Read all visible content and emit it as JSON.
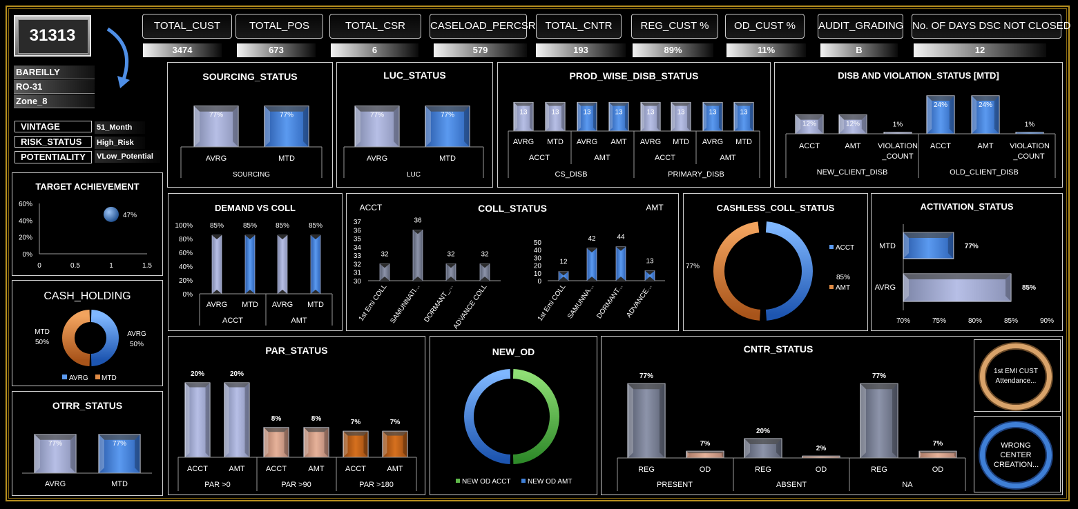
{
  "header": {
    "code": "31313",
    "locations": [
      "BAREILLY",
      "RO-31",
      "Zone_8"
    ]
  },
  "kpis": [
    {
      "label": "TOTAL_CUST",
      "value": "3474"
    },
    {
      "label": "TOTAL_POS",
      "value": "673"
    },
    {
      "label": "TOTAL_CSR",
      "value": "6"
    },
    {
      "label": "CASELOAD_PERCSR",
      "value": "579"
    },
    {
      "label": "TOTAL_CNTR",
      "value": "193"
    },
    {
      "label": "REG_CUST %",
      "value": "89%"
    },
    {
      "label": "OD_CUST %",
      "value": "11%"
    },
    {
      "label": "AUDIT_GRADING",
      "value": "B"
    },
    {
      "label": "No. OF DAYS DSC NOT CLOSED",
      "value": "12"
    }
  ],
  "profile": [
    {
      "label": "VINTAGE",
      "value": "51_Month"
    },
    {
      "label": "RISK_STATUS",
      "value": "High_Risk"
    },
    {
      "label": "POTENTIALITY",
      "value": "VLow_Potential"
    }
  ],
  "colors": {
    "gold": "#b8901f",
    "blue": "#3f7fd6",
    "lavender": "#b7bfe6",
    "peach": "#e6b29a",
    "orange": "#d6701e",
    "green": "#5fb84a"
  },
  "sourcing": {
    "title": "SOURCING_STATUS",
    "bars": [
      {
        "label": "AVRG",
        "value": "77%"
      },
      {
        "label": "MTD",
        "value": "77%"
      }
    ],
    "group": "SOURCING"
  },
  "luc": {
    "title": "LUC_STATUS",
    "bars": [
      {
        "label": "AVRG",
        "value": "77%"
      },
      {
        "label": "MTD",
        "value": "77%"
      }
    ],
    "group": "LUC"
  },
  "prod": {
    "title": "PROD_WISE_DISB_STATUS",
    "values": [
      "13",
      "13",
      "13",
      "13",
      "13",
      "13",
      "13",
      "13"
    ],
    "cats": [
      "AVRG",
      "MTD",
      "AVRG",
      "AMT",
      "AVRG",
      "MTD",
      "AVRG",
      "MTD"
    ],
    "sub": [
      "ACCT",
      "AMT",
      "ACCT",
      "AMT"
    ],
    "groups": [
      "CS_DISB",
      "PRIMARY_DISB"
    ]
  },
  "disb": {
    "title": "DISB AND VIOLATION_STATUS [MTD]",
    "values": [
      "12%",
      "12%",
      "1%",
      "24%",
      "24%",
      "1%"
    ],
    "cats": [
      "ACCT",
      "AMT",
      "VIOLATION",
      "ACCT",
      "AMT",
      "VIOLATION"
    ],
    "cats2": [
      "_COUNT",
      "_COUNT"
    ],
    "groups": [
      "NEW_CLIENT_DISB",
      "OLD_CLIENT_DISB"
    ]
  },
  "target": {
    "title": "TARGET ACHIEVEMENT",
    "point_label": "47%",
    "yticks": [
      "60%",
      "40%",
      "20%",
      "0%"
    ],
    "xticks": [
      "0",
      "0.5",
      "1",
      "1.5"
    ],
    "x": 1,
    "y": 0.47
  },
  "cash_holding": {
    "title": "CASH_HOLDING",
    "left_label": "MTD",
    "left_value": "50%",
    "right_label": "AVRG",
    "right_value": "50%",
    "legend": [
      "AVRG",
      "MTD"
    ]
  },
  "otrr": {
    "title": "OTRR_STATUS",
    "bars": [
      {
        "label": "AVRG",
        "value": "77%"
      },
      {
        "label": "MTD",
        "value": "77%"
      }
    ]
  },
  "demand": {
    "title": "DEMAND VS COLL",
    "yticks": [
      "100%",
      "80%",
      "60%",
      "40%",
      "20%",
      "0%"
    ],
    "values": [
      "85%",
      "85%",
      "85%",
      "85%"
    ],
    "cats": [
      "AVRG",
      "MTD",
      "AVRG",
      "MTD"
    ],
    "groups": [
      "ACCT",
      "AMT"
    ]
  },
  "coll": {
    "title": "COLL_STATUS",
    "left_label": "ACCT",
    "right_label": "AMT",
    "left_yticks": [
      "37",
      "36",
      "35",
      "34",
      "33",
      "32",
      "31",
      "30"
    ],
    "left_values": [
      "32",
      "36",
      "32",
      "32"
    ],
    "right_yticks": [
      "50",
      "40",
      "30",
      "20",
      "10",
      "0"
    ],
    "right_values": [
      "12",
      "42",
      "44",
      "13"
    ],
    "cats": [
      "1st Emi COLL",
      "SAMUNNATI...",
      "DORMANT_...",
      "ADVANCE COLL"
    ],
    "cats_right": [
      "1st Emi COLL",
      "SAMUNNA...",
      "DORMANT...",
      "ADVANCE..."
    ]
  },
  "cashless": {
    "title": "CASHLESS_COLL_STATUS",
    "left_value": "77%",
    "right_value": "85%",
    "legend": [
      "ACCT",
      "AMT"
    ]
  },
  "activation": {
    "title": "ACTIVATION_STATUS",
    "bars": [
      {
        "label": "MTD",
        "value": "77%"
      },
      {
        "label": "AVRG",
        "value": "85%"
      }
    ],
    "xticks": [
      "70%",
      "75%",
      "80%",
      "85%",
      "90%"
    ]
  },
  "par": {
    "title": "PAR_STATUS",
    "values": [
      "20%",
      "20%",
      "8%",
      "8%",
      "7%",
      "7%"
    ],
    "cats": [
      "ACCT",
      "AMT",
      "ACCT",
      "AMT",
      "ACCT",
      "AMT"
    ],
    "groups": [
      "PAR >0",
      "PAR >90",
      "PAR >180"
    ]
  },
  "new_od": {
    "title": "NEW_OD",
    "legend": [
      "NEW OD ACCT",
      "NEW OD AMT"
    ]
  },
  "cntr": {
    "title": "CNTR_STATUS",
    "values": [
      "77%",
      "7%",
      "20%",
      "2%",
      "77%",
      "7%"
    ],
    "cats": [
      "REG",
      "OD",
      "REG",
      "OD",
      "REG",
      "OD"
    ],
    "groups": [
      "PRESENT",
      "ABSENT",
      "NA"
    ]
  },
  "buttons": {
    "emi": "1st EMI CUST Attendance...",
    "wrong": "WRONG CENTER CREATION..."
  },
  "chart_data": [
    {
      "type": "bar",
      "title": "SOURCING_STATUS",
      "categories": [
        "AVRG",
        "MTD"
      ],
      "values": [
        77,
        77
      ],
      "xlabel": "SOURCING"
    },
    {
      "type": "bar",
      "title": "LUC_STATUS",
      "categories": [
        "AVRG",
        "MTD"
      ],
      "values": [
        77,
        77
      ],
      "xlabel": "LUC"
    },
    {
      "type": "bar",
      "title": "PROD_WISE_DISB_STATUS",
      "categories": [
        "CS_DISB ACCT AVRG",
        "CS_DISB ACCT MTD",
        "CS_DISB AMT AVRG",
        "CS_DISB AMT AMT",
        "PRIMARY_DISB ACCT AVRG",
        "PRIMARY_DISB ACCT MTD",
        "PRIMARY_DISB AMT AVRG",
        "PRIMARY_DISB AMT MTD"
      ],
      "values": [
        13,
        13,
        13,
        13,
        13,
        13,
        13,
        13
      ]
    },
    {
      "type": "bar",
      "title": "DISB AND VIOLATION_STATUS [MTD]",
      "categories": [
        "NEW ACCT",
        "NEW AMT",
        "NEW VIOLATION_COUNT",
        "OLD ACCT",
        "OLD AMT",
        "OLD VIOLATION_COUNT"
      ],
      "values": [
        12,
        12,
        1,
        24,
        24,
        1
      ]
    },
    {
      "type": "scatter",
      "title": "TARGET ACHIEVEMENT",
      "x": [
        1
      ],
      "y": [
        47
      ],
      "ylim": [
        0,
        60
      ],
      "xlim": [
        0,
        1.5
      ]
    },
    {
      "type": "pie",
      "title": "CASH_HOLDING",
      "categories": [
        "AVRG",
        "MTD"
      ],
      "values": [
        50,
        50
      ]
    },
    {
      "type": "bar",
      "title": "OTRR_STATUS",
      "categories": [
        "AVRG",
        "MTD"
      ],
      "values": [
        77,
        77
      ]
    },
    {
      "type": "bar",
      "title": "DEMAND VS COLL",
      "categories": [
        "ACCT AVRG",
        "ACCT MTD",
        "AMT AVRG",
        "AMT MTD"
      ],
      "values": [
        85,
        85,
        85,
        85
      ],
      "ylim": [
        0,
        100
      ]
    },
    {
      "type": "bar",
      "title": "COLL_STATUS",
      "series": [
        {
          "name": "ACCT",
          "values": [
            32,
            36,
            32,
            32
          ]
        },
        {
          "name": "AMT",
          "values": [
            12,
            42,
            44,
            13
          ]
        }
      ],
      "categories": [
        "1st Emi COLL",
        "SAMUNNATI...",
        "DORMANT_...",
        "ADVANCE COLL"
      ]
    },
    {
      "type": "pie",
      "title": "CASHLESS_COLL_STATUS",
      "categories": [
        "ACCT",
        "AMT"
      ],
      "values": [
        77,
        85
      ]
    },
    {
      "type": "bar",
      "title": "ACTIVATION_STATUS",
      "categories": [
        "MTD",
        "AVRG"
      ],
      "values": [
        77,
        85
      ],
      "xlim": [
        70,
        90
      ]
    },
    {
      "type": "bar",
      "title": "PAR_STATUS",
      "categories": [
        "PAR >0 ACCT",
        "PAR >0 AMT",
        "PAR >90 ACCT",
        "PAR >90 AMT",
        "PAR >180 ACCT",
        "PAR >180 AMT"
      ],
      "values": [
        20,
        20,
        8,
        8,
        7,
        7
      ]
    },
    {
      "type": "pie",
      "title": "NEW_OD",
      "categories": [
        "NEW OD ACCT",
        "NEW OD AMT"
      ],
      "values": [
        50,
        50
      ]
    },
    {
      "type": "bar",
      "title": "CNTR_STATUS",
      "categories": [
        "PRESENT REG",
        "PRESENT OD",
        "ABSENT REG",
        "ABSENT OD",
        "NA REG",
        "NA OD"
      ],
      "values": [
        77,
        7,
        20,
        2,
        77,
        7
      ]
    }
  ]
}
